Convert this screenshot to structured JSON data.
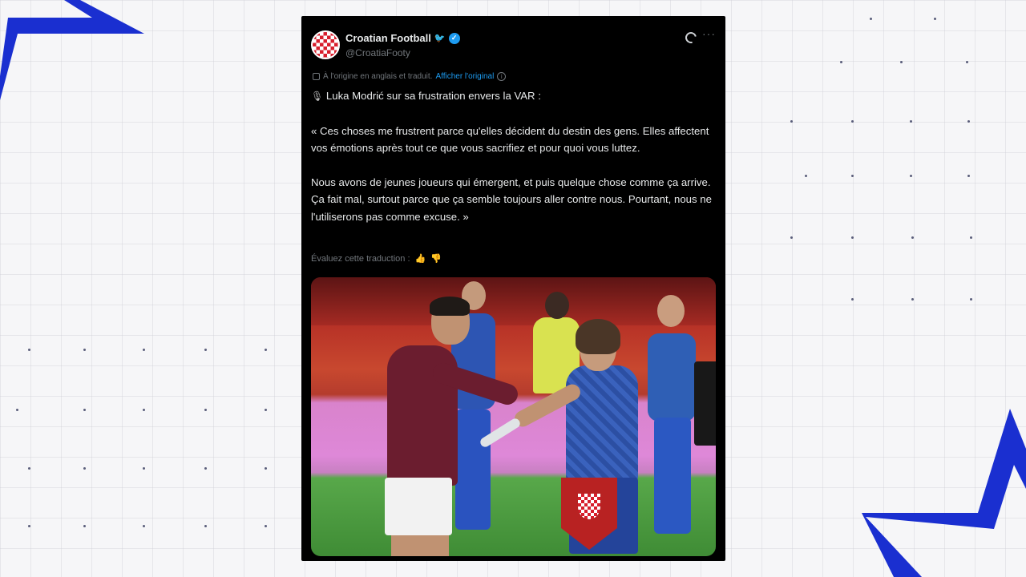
{
  "tweet": {
    "account_name": "Croatian Football",
    "handle": "@CroatiaFooty",
    "translation_note": "À l'origine en anglais et traduit.",
    "show_original": "Afficher l'original",
    "headline": "Luka Modrić sur sa frustration envers la VAR :",
    "paragraph_1": "« Ces choses me frustrent parce qu'elles décident du destin des gens. Elles affectent vos émotions après tout ce que vous sacrifiez et pour quoi vous luttez.",
    "paragraph_2": "Nous avons de jeunes joueurs qui émergent, et puis quelque chose comme ça arrive. Ça fait mal, surtout parce que ça semble toujours aller contre nous. Pourtant, nous ne l'utiliserons pas comme excuse. »",
    "rate_translation": "Évaluez cette traduction :"
  },
  "icons": [
    "avatar-crest",
    "twitter-bird-icon",
    "verified-badge-icon",
    "grok-icon",
    "more-icon",
    "translate-icon",
    "info-icon",
    "microphone-icon",
    "thumbs-up-icon",
    "thumbs-down-icon"
  ],
  "colors": {
    "accent": "#1d9bf0",
    "card_bg": "#000000",
    "deco_blue": "#1a2fd0",
    "text": "#e7e9ea",
    "muted": "#71767b"
  }
}
